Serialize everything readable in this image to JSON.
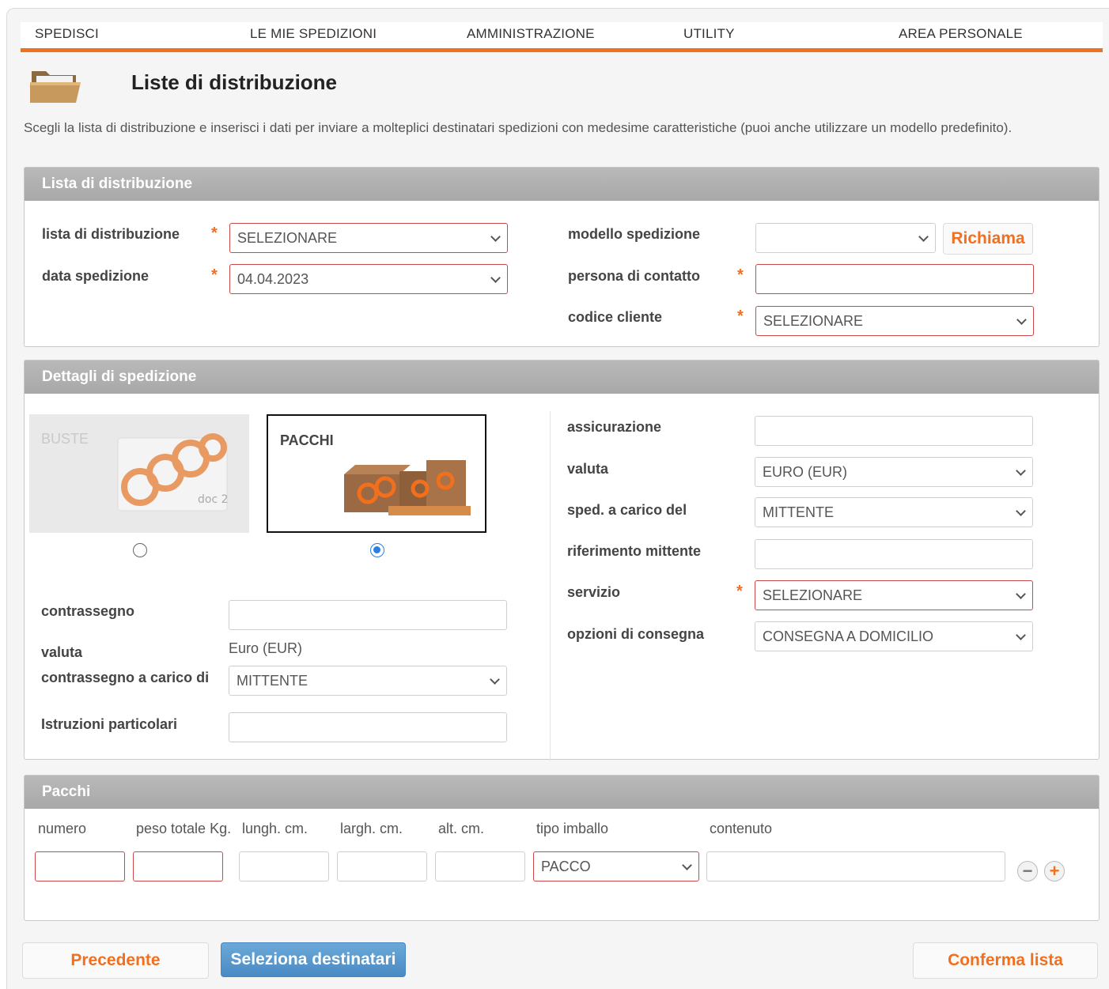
{
  "nav": [
    "SPEDISCI",
    "LE MIE SPEDIZIONI",
    "AMMINISTRAZIONE",
    "UTILITY",
    "AREA PERSONALE"
  ],
  "header": {
    "title": "Liste di distribuzione",
    "intro": "Scegli la lista di distribuzione e inserisci i dati per inviare a molteplici destinatari spedizioni con medesime caratteristiche (puoi anche utilizzare un modello predefinito)."
  },
  "lista": {
    "title": "Lista di distribuzione",
    "lista_label": "lista di distribuzione",
    "lista_value": "SELEZIONARE",
    "data_label": "data spedizione",
    "data_value": "04.04.2023",
    "modello_label": "modello spedizione",
    "modello_value": "",
    "richiama": "Richiama",
    "persona_label": "persona di contatto",
    "persona_value": "",
    "codice_label": "codice cliente",
    "codice_value": "SELEZIONARE"
  },
  "dettagli": {
    "title": "Dettagli di spedizione",
    "buste": "BUSTE",
    "pacchi": "PACCHI",
    "buste_badge": "doc 2",
    "selected_type": "PACCHI",
    "contrassegno_label": "contrassegno",
    "contrassegno_value": "",
    "valuta_label": "valuta",
    "valuta_value": "Euro (EUR)",
    "carico_label": "contrassegno a carico di",
    "carico_value": "MITTENTE",
    "istruzioni_label": "Istruzioni particolari",
    "istruzioni_value": "",
    "assicurazione_label": "assicurazione",
    "assicurazione_value": "",
    "valuta2_label": "valuta",
    "valuta2_value": "EURO (EUR)",
    "sped_carico_label": "sped. a carico del",
    "sped_carico_value": "MITTENTE",
    "rif_label": "riferimento mittente",
    "rif_value": "",
    "servizio_label": "servizio",
    "servizio_value": "SELEZIONARE",
    "opzioni_label": "opzioni di consegna",
    "opzioni_value": "CONSEGNA A DOMICILIO"
  },
  "pacchi": {
    "title": "Pacchi",
    "columns": [
      "numero",
      "peso totale Kg.",
      "lungh. cm.",
      "largh. cm.",
      "alt. cm.",
      "tipo imballo",
      "contenuto"
    ],
    "tipo_value": "PACCO",
    "minus": "−",
    "plus": "+"
  },
  "footer": {
    "precedente": "Precedente",
    "seleziona": "Seleziona destinatari",
    "conferma": "Conferma lista"
  },
  "colors": {
    "accent": "#f26f1e",
    "panel_head": "#b0b0b0",
    "blue_button": "#4a8ac4"
  }
}
